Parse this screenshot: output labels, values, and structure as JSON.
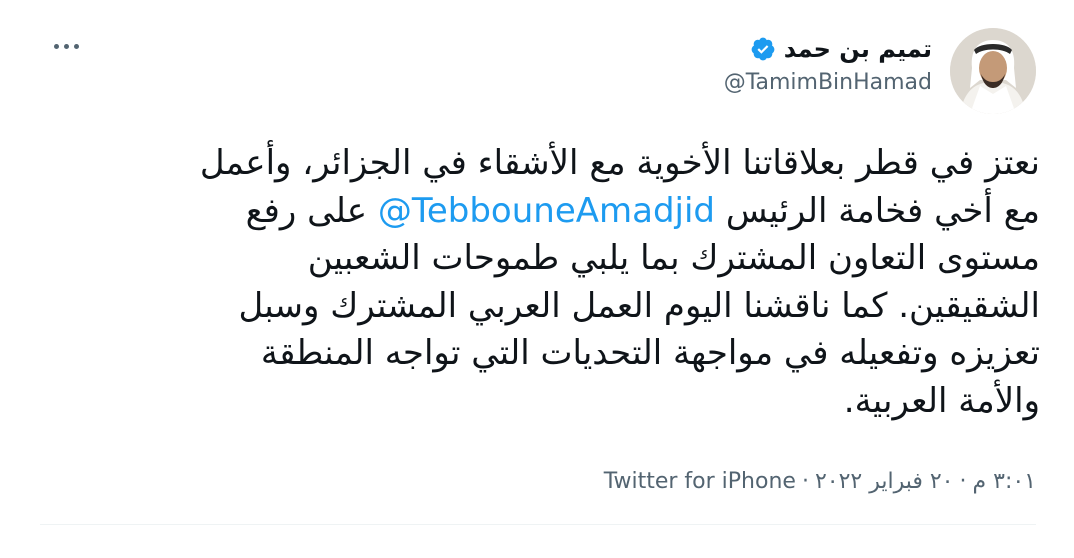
{
  "author": {
    "display_name": "تميم بن حمد",
    "handle": "@TamimBinHamad",
    "verified": true
  },
  "tweet": {
    "lines": [
      "نعتز في قطر بعلاقاتنا الأخوية مع الأشقاء في الجزائر، وأعمل",
      "مستوى التعاون المشترك بما يلبي طموحات الشعبين",
      "الشقيقين. كما ناقشنا اليوم العمل العربي المشترك وسبل",
      "تعزيزه وتفعيله في مواجهة التحديات التي تواجه المنطقة",
      "والأمة العربية."
    ],
    "line2_prefix": "مع أخي فخامة الرئيس ",
    "mention": "@TebbouneAmadjid",
    "line2_suffix": " على رفع"
  },
  "meta": {
    "time": "٣:٠١ م",
    "date": "٢٠ فبراير ٢٠٢٢",
    "separator": "·",
    "source": "Twitter for iPhone"
  },
  "icons": {
    "verified": "verified-badge-icon",
    "more": "more-options-icon",
    "accent": "#1d9bf0"
  }
}
